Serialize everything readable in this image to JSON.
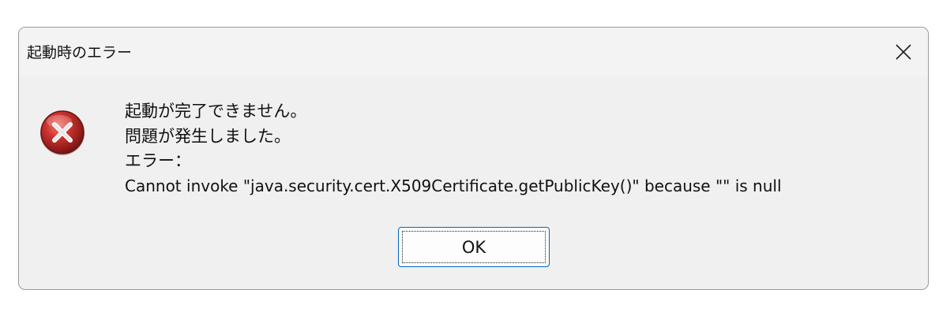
{
  "window": {
    "title": "起動時のエラー",
    "close_icon": "close-icon"
  },
  "message": {
    "icon": "error-icon",
    "line1": "起動が完了できません。",
    "line2": "問題が発生しました。",
    "line3": "エラー：",
    "line4": "Cannot invoke \"java.security.cert.X509Certificate.getPublicKey()\" because \"\" is null"
  },
  "buttons": {
    "ok_label": "OK"
  },
  "colors": {
    "dialog_bg": "#f0f0f0",
    "accent_border": "#0067c0",
    "error_red": "#c0282c"
  }
}
